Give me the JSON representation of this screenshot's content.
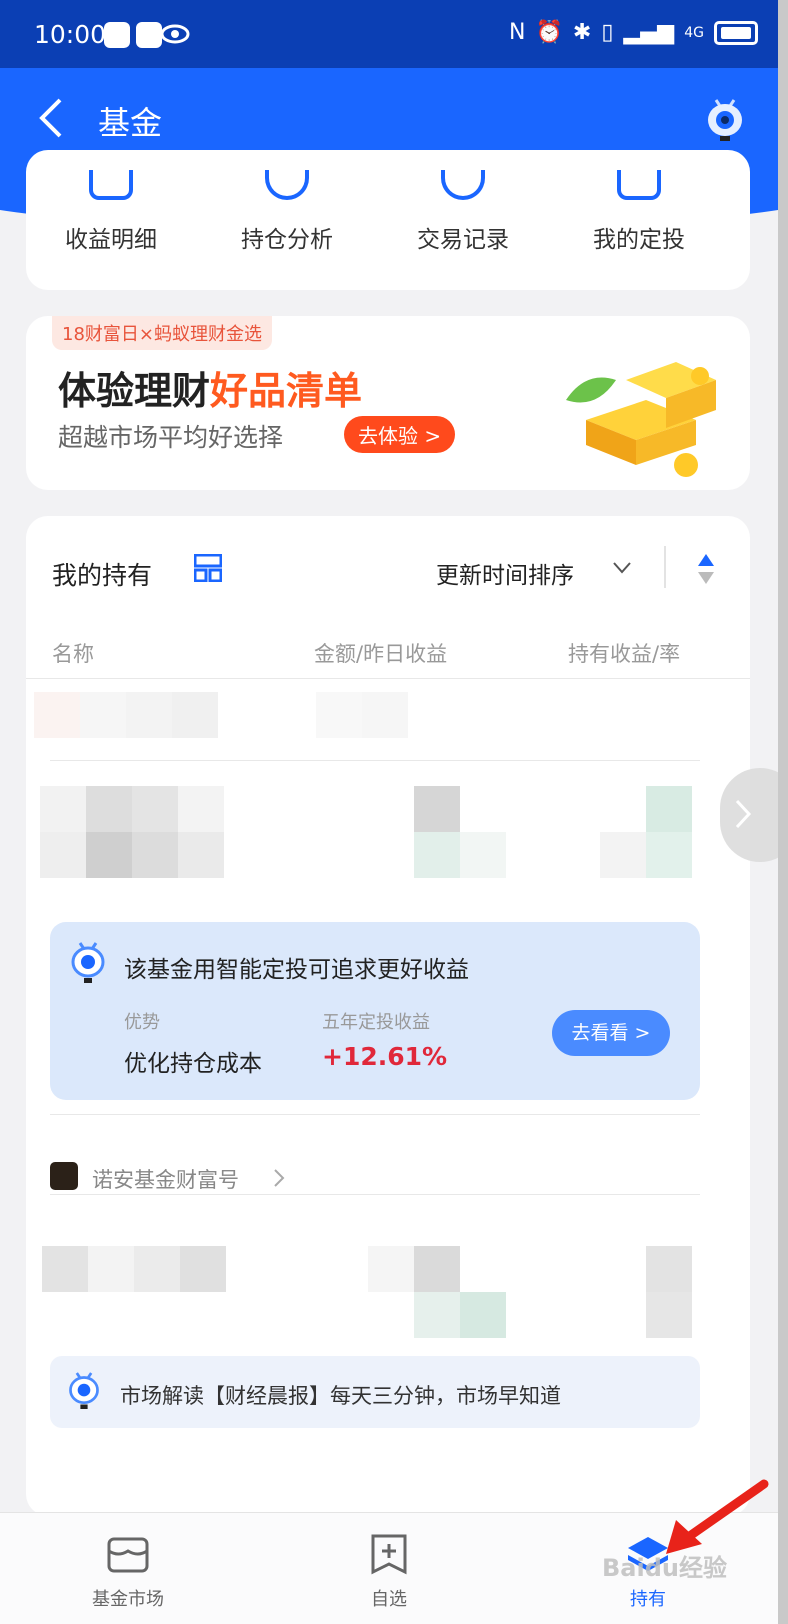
{
  "status": {
    "time": "10:00",
    "network": "4G"
  },
  "header": {
    "title": "基金"
  },
  "quick_actions": [
    {
      "label": "收益明细",
      "icon": "document-icon"
    },
    {
      "label": "持仓分析",
      "icon": "pie-chart-icon"
    },
    {
      "label": "交易记录",
      "icon": "shield-check-icon"
    },
    {
      "label": "我的定投",
      "icon": "calendar-check-icon"
    }
  ],
  "banner": {
    "tag": "18财富日×蚂蚁理财金选",
    "title_main": "体验理财",
    "title_highlight": "好品清单",
    "subtitle": "超越市场平均好选择",
    "button": "去体验 >"
  },
  "holdings": {
    "title": "我的持有",
    "sort_label": "更新时间排序",
    "columns": [
      "名称",
      "金额/昨日收益",
      "持有收益/率"
    ],
    "advice": {
      "title": "该基金用智能定投可追求更好收益",
      "label_1": "优势",
      "value_1": "优化持仓成本",
      "label_2": "五年定投收益",
      "value_2": "+12.61%",
      "button": "去看看 >"
    },
    "brand": "诺安基金财富号",
    "news": "市场解读【财经晨报】每天三分钟，市场早知道"
  },
  "tabbar": {
    "items": [
      {
        "label": "基金市场",
        "icon": "store-icon",
        "active": false
      },
      {
        "label": "自选",
        "icon": "bookmark-add-icon",
        "active": false
      },
      {
        "label": "持有",
        "icon": "layers-icon",
        "active": true
      }
    ]
  },
  "watermark": "Baidu经验",
  "colors": {
    "brand_blue": "#1a66ff",
    "status_blue": "#0b3fb4",
    "gain_red": "#e0283a",
    "promo_orange": "#ff5a1f"
  }
}
